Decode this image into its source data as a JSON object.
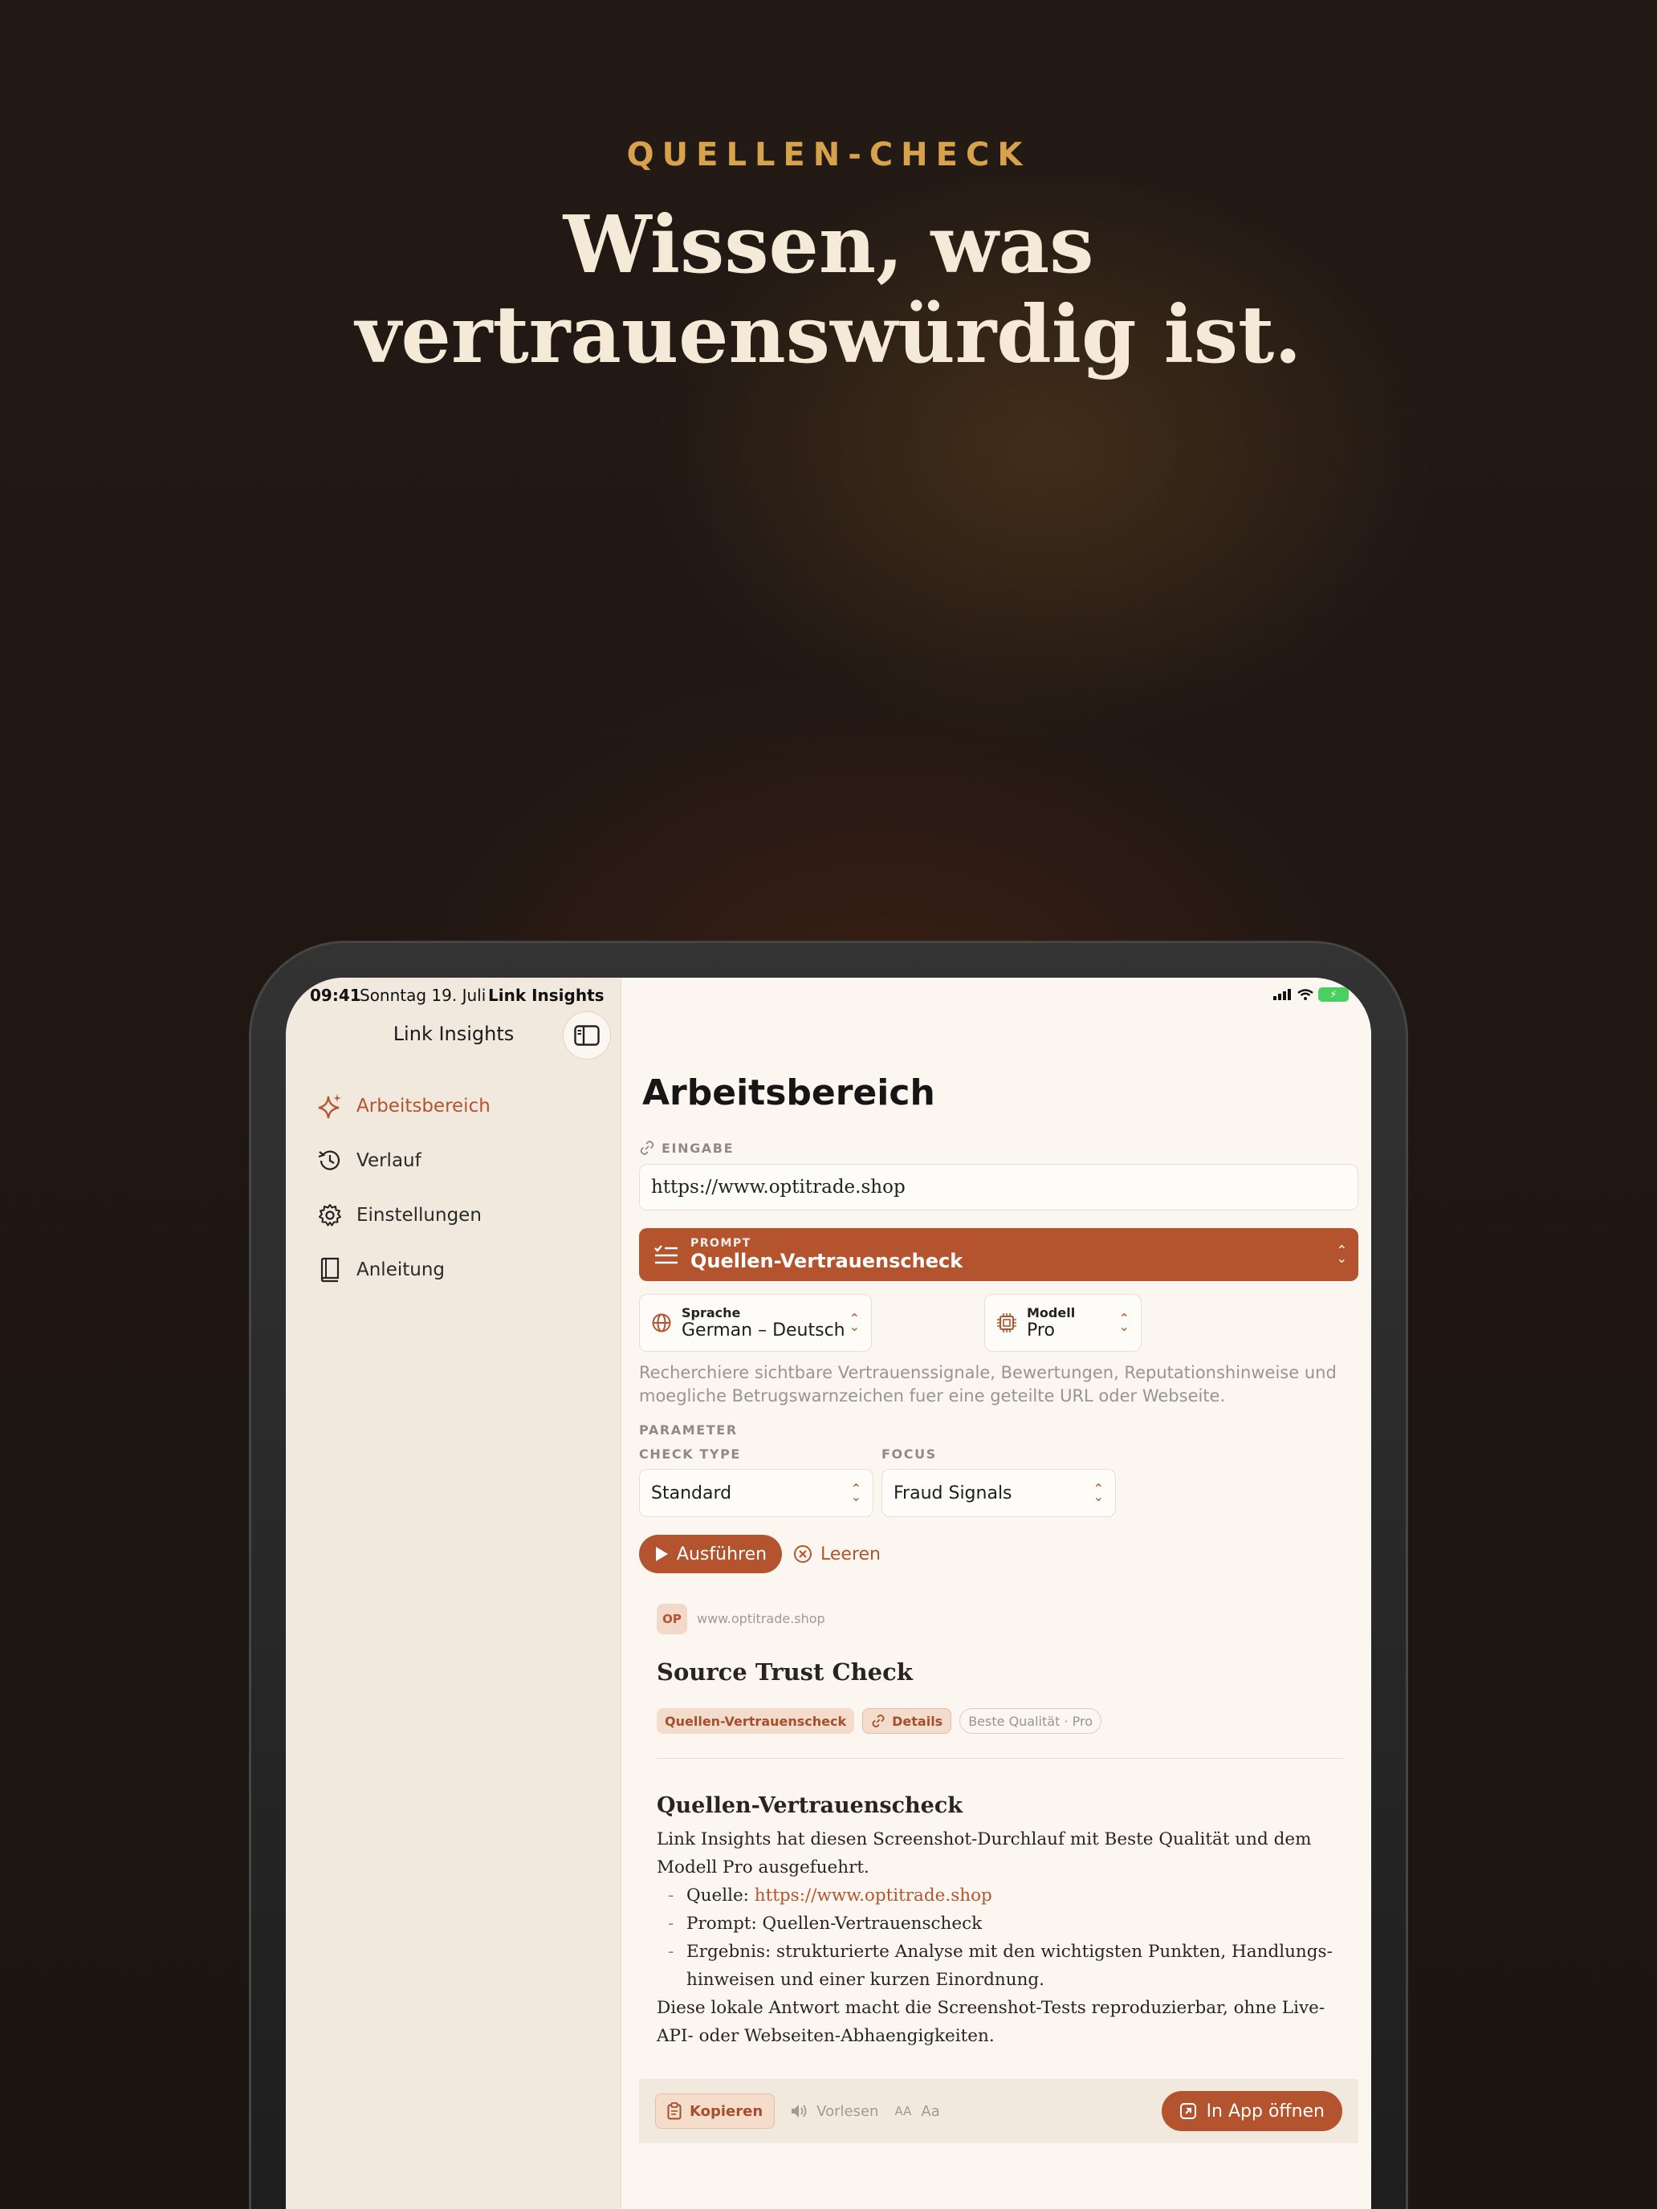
{
  "hero": {
    "kicker": "QUELLEN-CHECK",
    "headline_line1": "Wissen, was",
    "headline_line2": "vertrauenswürdig ist."
  },
  "statusbar": {
    "time": "09:41",
    "date": "Sonntag 19. Juli",
    "app": "Link Insights"
  },
  "sidebar": {
    "title": "Link Insights",
    "items": [
      {
        "label": "Arbeitsbereich",
        "icon": "sparkles-icon",
        "active": true
      },
      {
        "label": "Verlauf",
        "icon": "history-icon",
        "active": false
      },
      {
        "label": "Einstellungen",
        "icon": "gear-icon",
        "active": false
      },
      {
        "label": "Anleitung",
        "icon": "book-icon",
        "active": false
      }
    ]
  },
  "main": {
    "title": "Arbeitsbereich",
    "input_label": "EINGABE",
    "input_value": "https://www.optitrade.shop",
    "prompt": {
      "label": "PROMPT",
      "value": "Quellen-Vertrauenscheck"
    },
    "language": {
      "label": "Sprache",
      "value": "German – Deutsch"
    },
    "model": {
      "label": "Modell",
      "value": "Pro"
    },
    "description": "Recherchiere sichtbare Vertrauenssignale, Bewertungen, Reputationshinweise und moegliche Betrugswarnzeichen fuer eine geteilte URL oder Webseite.",
    "parameter_label": "PARAMETER",
    "check_type": {
      "label": "CHECK TYPE",
      "value": "Standard"
    },
    "focus": {
      "label": "FOCUS",
      "value": "Fraud Signals"
    },
    "run_label": "Ausführen",
    "clear_label": "Leeren"
  },
  "result": {
    "badge": "OP",
    "domain": "www.optitrade.shop",
    "title": "Source Trust Check",
    "chips": [
      "Quellen-Vertrauenscheck",
      "Details",
      "Beste Qualität · Pro"
    ],
    "section_title": "Quellen-Vertrauenscheck",
    "intro": "Link Insights hat diesen Screenshot-Durchlauf mit Beste Qualität und dem Modell Pro ausgefuehrt.",
    "list": {
      "source_label": "Quelle: ",
      "source_link": "https://www.optitrade.shop",
      "prompt_item": "Prompt: Quellen-Vertrauenscheck",
      "result_item": "Ergebnis: strukturierte Analyse mit den wichtigsten Punkten, Handlungs-hinweisen und einer kurzen Einordnung."
    },
    "outro": "Diese lokale Antwort macht die Screenshot-Tests reproduzierbar, ohne Live-API- oder Webseiten-Abhaengigkeiten."
  },
  "footer": {
    "copy": "Kopieren",
    "read": "Vorlesen",
    "font_small": "AA",
    "font_large": "Aa",
    "open": "In App öffnen"
  },
  "colors": {
    "accent": "#b4542e",
    "kicker": "#d8a14c",
    "headline": "#f5ead8"
  }
}
